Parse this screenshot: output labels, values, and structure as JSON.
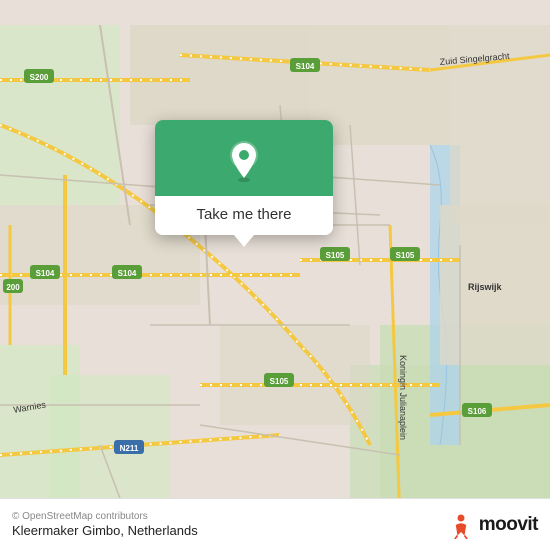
{
  "map": {
    "background_color": "#e8e0d8",
    "center_lat": 52.06,
    "center_lon": 4.29
  },
  "popup": {
    "button_label": "Take me there",
    "pin_color": "#ffffff",
    "background_color": "#3caa6e"
  },
  "bottom_bar": {
    "attribution": "© OpenStreetMap contributors",
    "location_name": "Kleermaker Gimbo, Netherlands",
    "moovit_logo_text": "moovit"
  },
  "road_labels": [
    "S200",
    "S104",
    "S104",
    "S104",
    "S105",
    "S105",
    "S105",
    "S106",
    "N211",
    "200"
  ]
}
